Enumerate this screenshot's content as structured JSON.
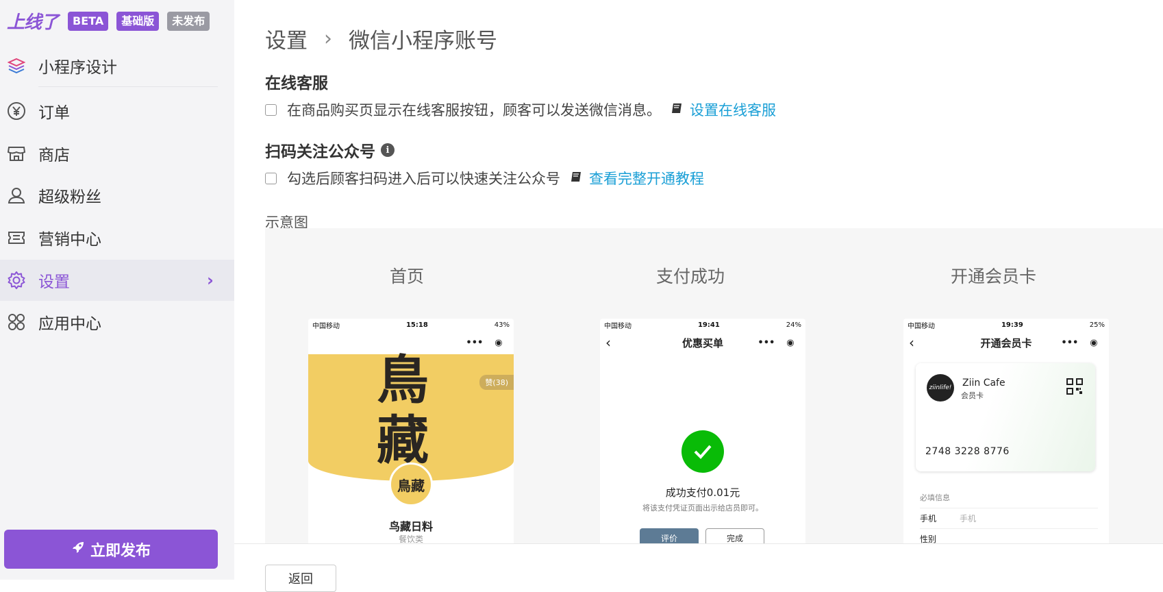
{
  "sidebar": {
    "logo": "上线了",
    "badges": [
      "BETA",
      "基础版",
      "未发布"
    ],
    "design_label": "小程序设计",
    "items": [
      {
        "label": "订单",
        "icon": "yen-circle-icon"
      },
      {
        "label": "商店",
        "icon": "store-icon"
      },
      {
        "label": "超级粉丝",
        "icon": "user-icon"
      },
      {
        "label": "营销中心",
        "icon": "ticket-icon"
      },
      {
        "label": "设置",
        "icon": "gear-icon",
        "active": true
      },
      {
        "label": "应用中心",
        "icon": "apps-icon"
      }
    ],
    "publish_label": "立即发布"
  },
  "breadcrumb": {
    "parent": "设置",
    "current": "微信小程序账号"
  },
  "online_service": {
    "title": "在线客服",
    "option_text": "在商品购买页显示在线客服按钮，顾客可以发送微信消息。",
    "link": "设置在线客服",
    "checked": false
  },
  "follow_account": {
    "title": "扫码关注公众号",
    "option_text": "勾选后顾客扫码进入后可以快速关注公众号",
    "link": "查看完整开通教程",
    "checked": false
  },
  "preview": {
    "label": "示意图",
    "screens": [
      {
        "title": "首页",
        "status": {
          "carrier": "中国移动",
          "time": "15:18",
          "battery": "43%"
        },
        "banner_text_1": "鳥",
        "banner_text_2": "藏",
        "like_chip": "赞(38)",
        "avatar_text": "鳥藏",
        "shop_name": "鸟藏日料",
        "shop_category": "餐饮类"
      },
      {
        "title": "支付成功",
        "status": {
          "carrier": "中国移动",
          "time": "19:41",
          "battery": "24%"
        },
        "header": "优惠买单",
        "message": "成功支付0.01元",
        "sub": "将该支付凭证页面出示给店员即可。",
        "btn_rate": "评价",
        "btn_done": "完成"
      },
      {
        "title": "开通会员卡",
        "status": {
          "carrier": "中国移动",
          "time": "19:39",
          "battery": "25%"
        },
        "header": "开通会员卡",
        "card_logo": "ziinlife!",
        "card_name": "Ziin Cafe",
        "card_type": "会员卡",
        "card_number": "2748 3228 8776",
        "required_label": "必填信息",
        "field_phone_label": "手机",
        "field_phone_placeholder": "手机",
        "field_gender_label": "性别"
      }
    ]
  },
  "footer": {
    "back_label": "返回"
  },
  "colors": {
    "accent": "#8b55d6",
    "link": "#1a9fd6",
    "success": "#09bb07"
  }
}
